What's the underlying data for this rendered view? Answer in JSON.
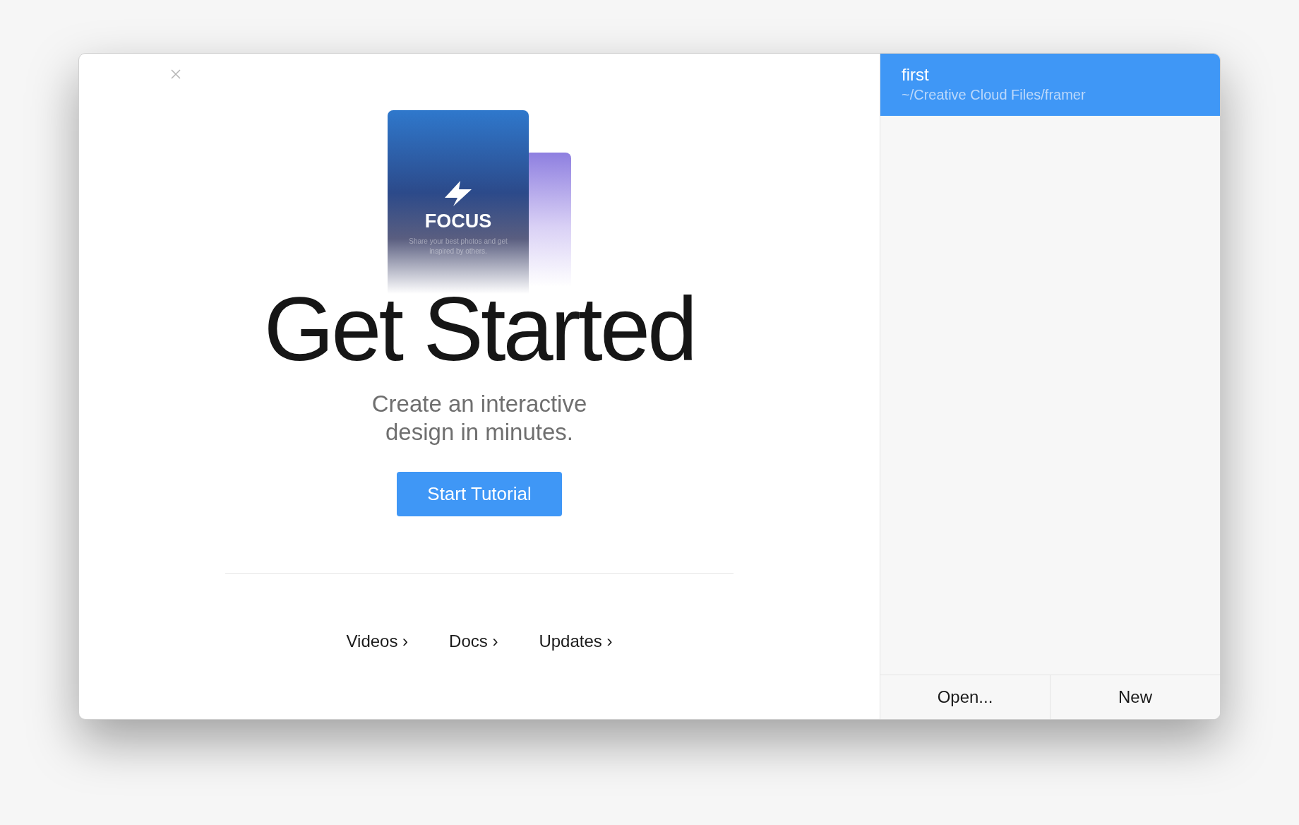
{
  "preview_card": {
    "title": "FOCUS",
    "tagline": "Share your best photos and get inspired by others."
  },
  "heading": "Get Started",
  "subtitle": "Create an interactive design in minutes.",
  "primary_button": "Start Tutorial",
  "links": [
    {
      "label": "Videos ›"
    },
    {
      "label": "Docs ›"
    },
    {
      "label": "Updates ›"
    }
  ],
  "recent_projects": [
    {
      "name": "first",
      "path": "~/Creative Cloud Files/framer",
      "selected": true
    }
  ],
  "footer_buttons": [
    "Open...",
    "New"
  ]
}
